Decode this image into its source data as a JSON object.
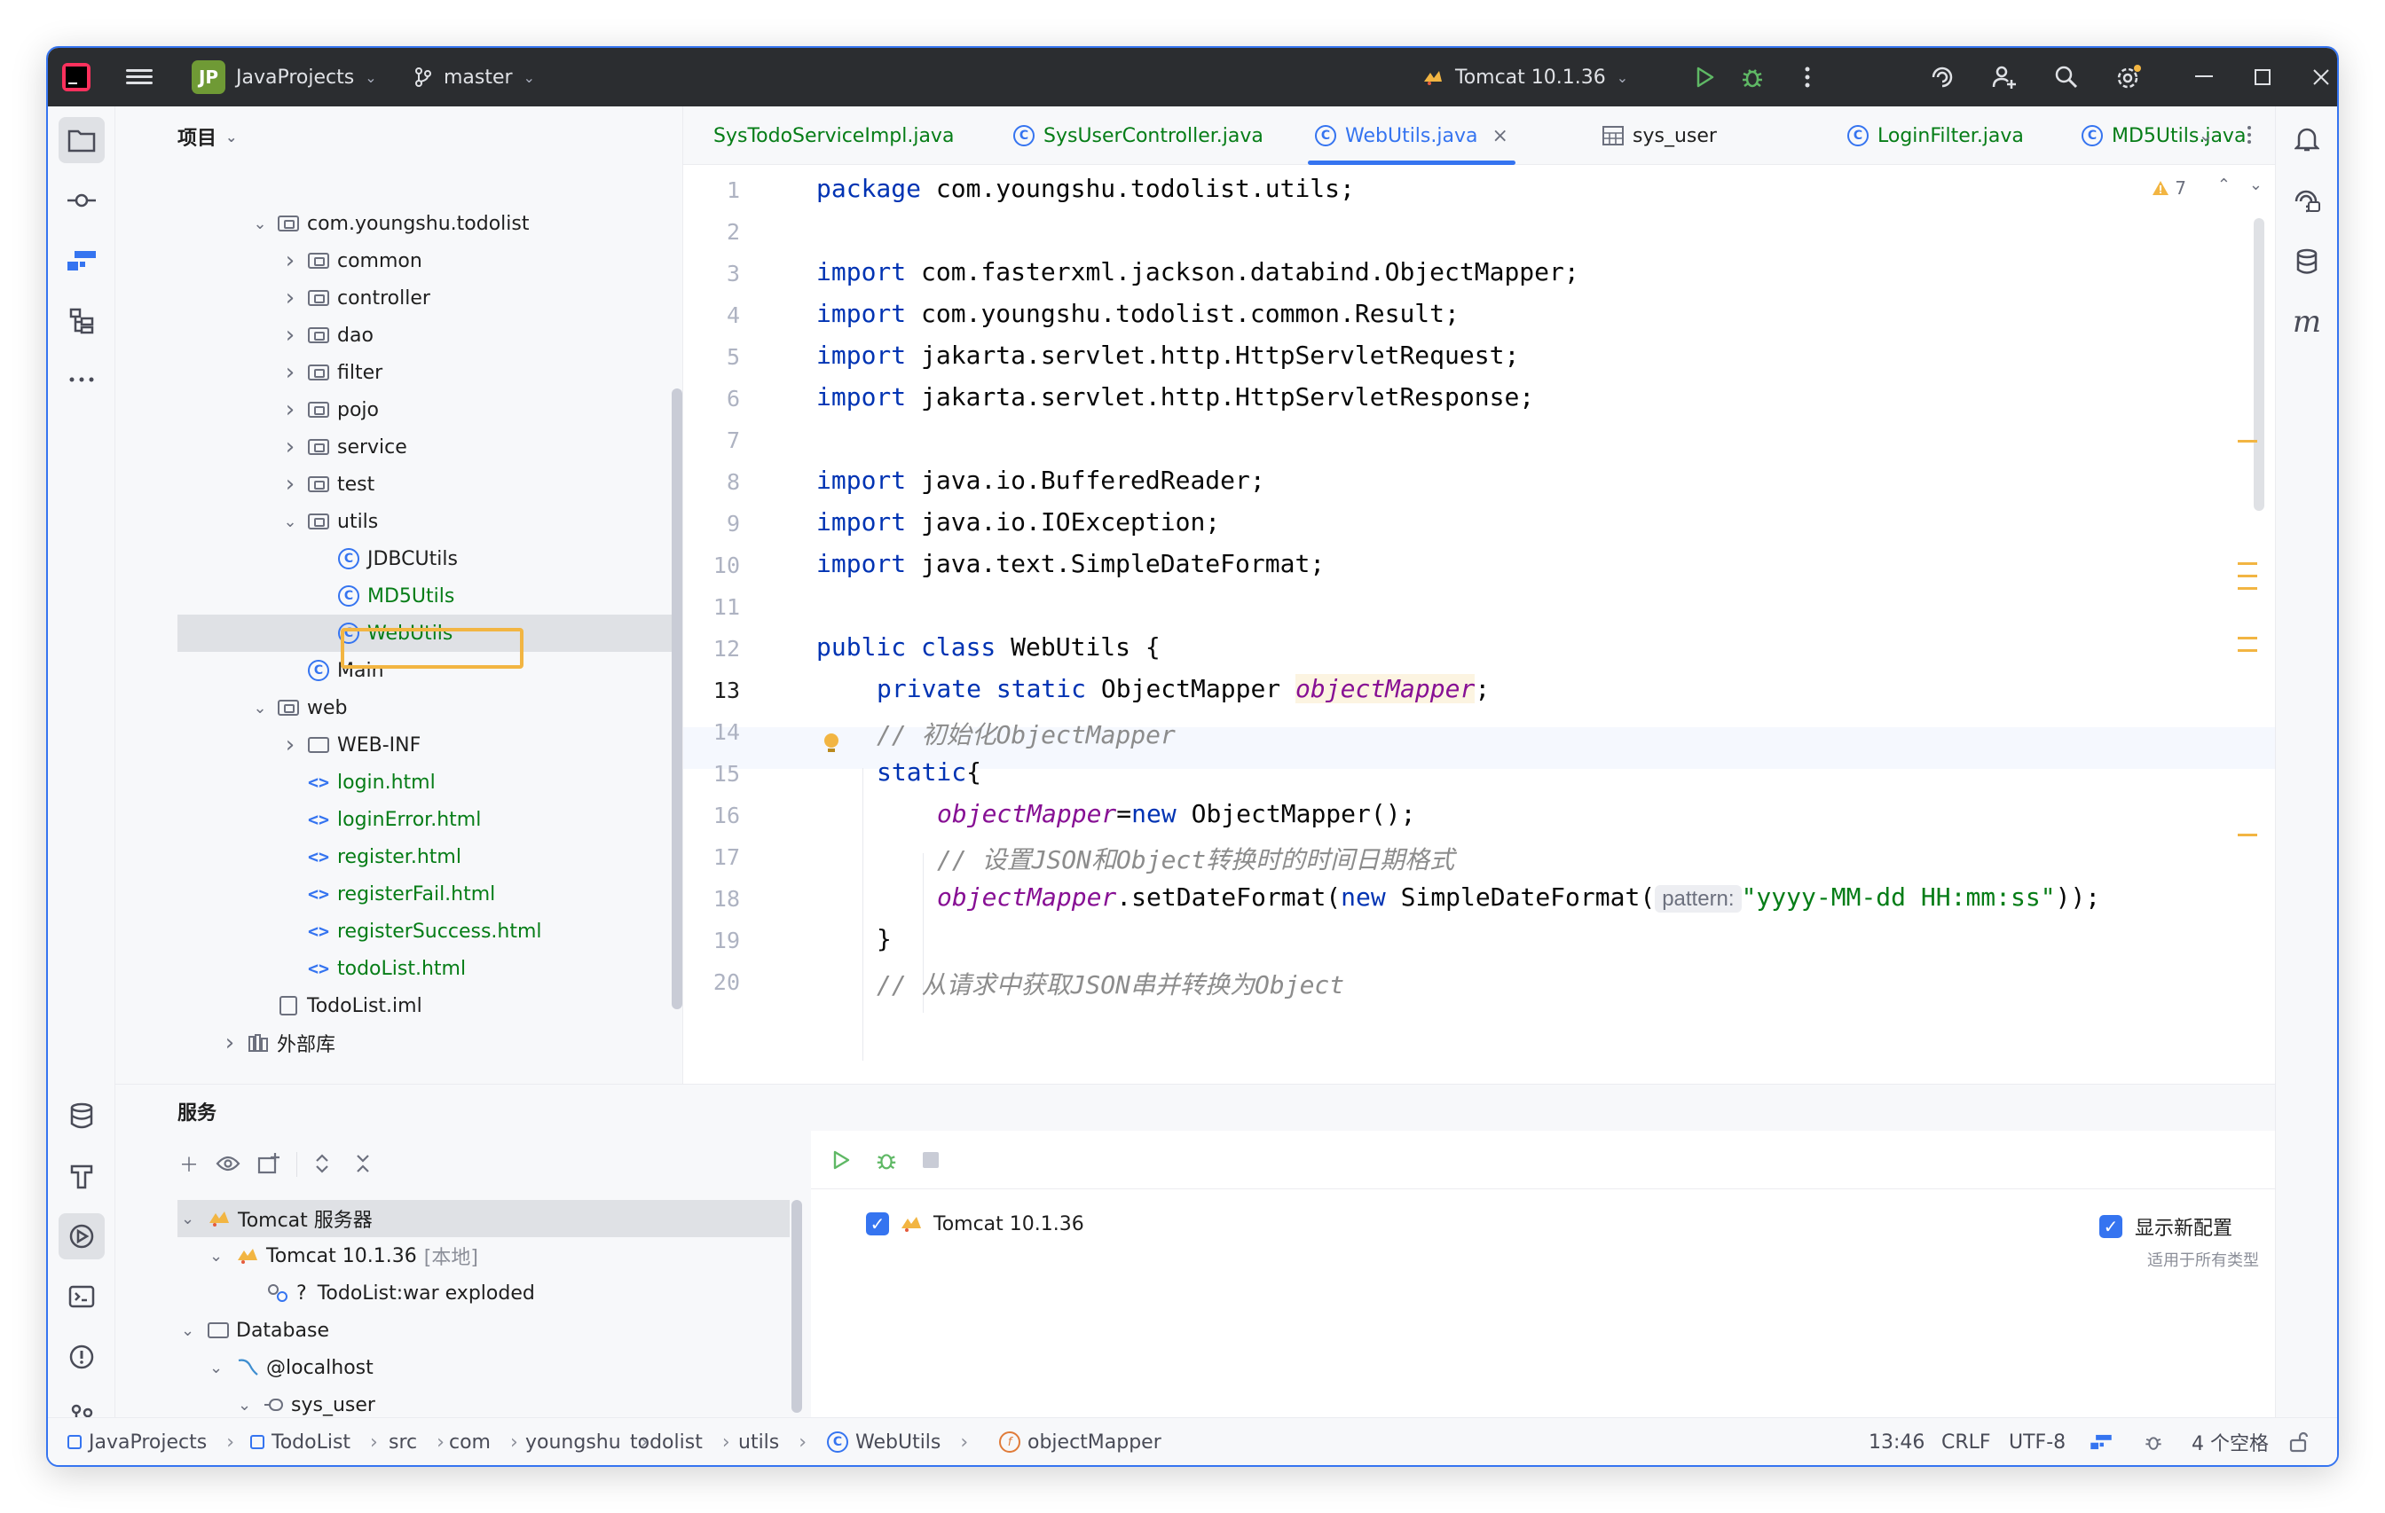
{
  "titlebar": {
    "project_badge": "JP",
    "project_name": "JavaProjects",
    "branch": "master",
    "run_config": "Tomcat 10.1.36"
  },
  "project_panel": {
    "title": "项目",
    "tree": [
      {
        "label": "com.youngshu.todolist",
        "indent": 1,
        "type": "package",
        "expanded": true
      },
      {
        "label": "common",
        "indent": 2,
        "type": "package",
        "expanded": false
      },
      {
        "label": "controller",
        "indent": 2,
        "type": "package",
        "expanded": false
      },
      {
        "label": "dao",
        "indent": 2,
        "type": "package",
        "expanded": false
      },
      {
        "label": "filter",
        "indent": 2,
        "type": "package",
        "expanded": false
      },
      {
        "label": "pojo",
        "indent": 2,
        "type": "package",
        "expanded": false
      },
      {
        "label": "service",
        "indent": 2,
        "type": "package",
        "expanded": false
      },
      {
        "label": "test",
        "indent": 2,
        "type": "package",
        "expanded": false
      },
      {
        "label": "utils",
        "indent": 2,
        "type": "package",
        "expanded": true
      },
      {
        "label": "JDBCUtils",
        "indent": 3,
        "type": "class"
      },
      {
        "label": "MD5Utils",
        "indent": 3,
        "type": "class-green"
      },
      {
        "label": "WebUtils",
        "indent": 3,
        "type": "class-green",
        "selected": true
      },
      {
        "label": "Main",
        "indent": 2,
        "type": "main"
      },
      {
        "label": "web",
        "indent": 1,
        "type": "folder",
        "expanded": true
      },
      {
        "label": "WEB-INF",
        "indent": 2,
        "type": "folder-plain",
        "expanded": false
      },
      {
        "label": "login.html",
        "indent": 2,
        "type": "html"
      },
      {
        "label": "loginError.html",
        "indent": 2,
        "type": "html"
      },
      {
        "label": "register.html",
        "indent": 2,
        "type": "html"
      },
      {
        "label": "registerFail.html",
        "indent": 2,
        "type": "html"
      },
      {
        "label": "registerSuccess.html",
        "indent": 2,
        "type": "html"
      },
      {
        "label": "todoList.html",
        "indent": 2,
        "type": "html"
      },
      {
        "label": "TodoList.iml",
        "indent": 1,
        "type": "iml"
      },
      {
        "label": "外部库",
        "indent": 0,
        "type": "lib",
        "expanded": false
      }
    ]
  },
  "tabs": [
    {
      "label": "SysTodoServiceImpl.java",
      "active": false
    },
    {
      "label": "SysUserController.java",
      "active": false
    },
    {
      "label": "WebUtils.java",
      "active": true
    },
    {
      "label": "sys_user",
      "active": false
    },
    {
      "label": "LoginFilter.java",
      "active": false
    },
    {
      "label": "MD5Utils.java",
      "active": false
    },
    {
      "label": "MD",
      "active": false
    }
  ],
  "editor": {
    "warnings_count": "7",
    "current_line": 13,
    "lines": [
      "1",
      "2",
      "3",
      "4",
      "5",
      "6",
      "7",
      "8",
      "9",
      "10",
      "11",
      "12",
      "13",
      "14",
      "15",
      "16",
      "17",
      "18",
      "19",
      "20"
    ],
    "code": {
      "l1_kw": "package",
      "l1_rest": " com.youngshu.todolist.utils;",
      "import_kw": "import",
      "l3": " com.fasterxml.jackson.databind.ObjectMapper;",
      "l4": " com.youngshu.todolist.common.Result;",
      "l5": " jakarta.servlet.http.HttpServletRequest;",
      "l6": " jakarta.servlet.http.HttpServletResponse;",
      "l8": " java.io.BufferedReader;",
      "l9": " java.io.IOException;",
      "l10": " java.text.SimpleDateFormat;",
      "l12_kw": "public class",
      "l12_rest": " WebUtils {",
      "l13_kw": "private static",
      "l13_type": " ObjectMapper ",
      "l13_field": "objectMapper",
      "l13_end": ";",
      "l14": "// 初始化ObjectMapper",
      "l15_kw": "static",
      "l15_rest": "{",
      "l16_field": "objectMapper",
      "l16_eq": "=",
      "l16_kw": "new",
      "l16_rest": " ObjectMapper();",
      "l17": "// 设置JSON和Object转换时的时间日期格式",
      "l18_field": "objectMapper",
      "l18_a": ".setDateFormat(",
      "l18_kw": "new",
      "l18_b": " SimpleDateFormat(",
      "l18_hint": "pattern:",
      "l18_str": "\"yyyy-MM-dd HH:mm:ss\"",
      "l18_end": "));",
      "l19": "}",
      "l20": "// 从请求中获取JSON串并转换为Object"
    }
  },
  "services": {
    "title": "服务",
    "tree": {
      "tomcat_server": "Tomcat 服务器",
      "tomcat_instance": "Tomcat 10.1.36",
      "tomcat_local": "[本地]",
      "artifact_q": "?",
      "artifact": "TodoList:war exploded",
      "database": "Database",
      "localhost": "@localhost",
      "schema": "sys_user",
      "table": "sys_user"
    },
    "right": {
      "config_item": "Tomcat 10.1.36",
      "show_new_config": "显示新配置",
      "applies_to_all": "适用于所有类型"
    }
  },
  "statusbar": {
    "breadcrumb": [
      "JavaProjects",
      "TodoList",
      "src",
      "com",
      "youngshu",
      "todolist",
      "utils",
      "WebUtils",
      "objectMapper"
    ],
    "position": "13:46",
    "line_sep": "CRLF",
    "encoding": "UTF-8",
    "indent": "4 个空格"
  },
  "colors": {
    "accent": "#3574f0",
    "keyword": "#0033b3",
    "field": "#871094",
    "string": "#067d17",
    "comment": "#8c8c8c",
    "highlight": "#f2b542"
  }
}
